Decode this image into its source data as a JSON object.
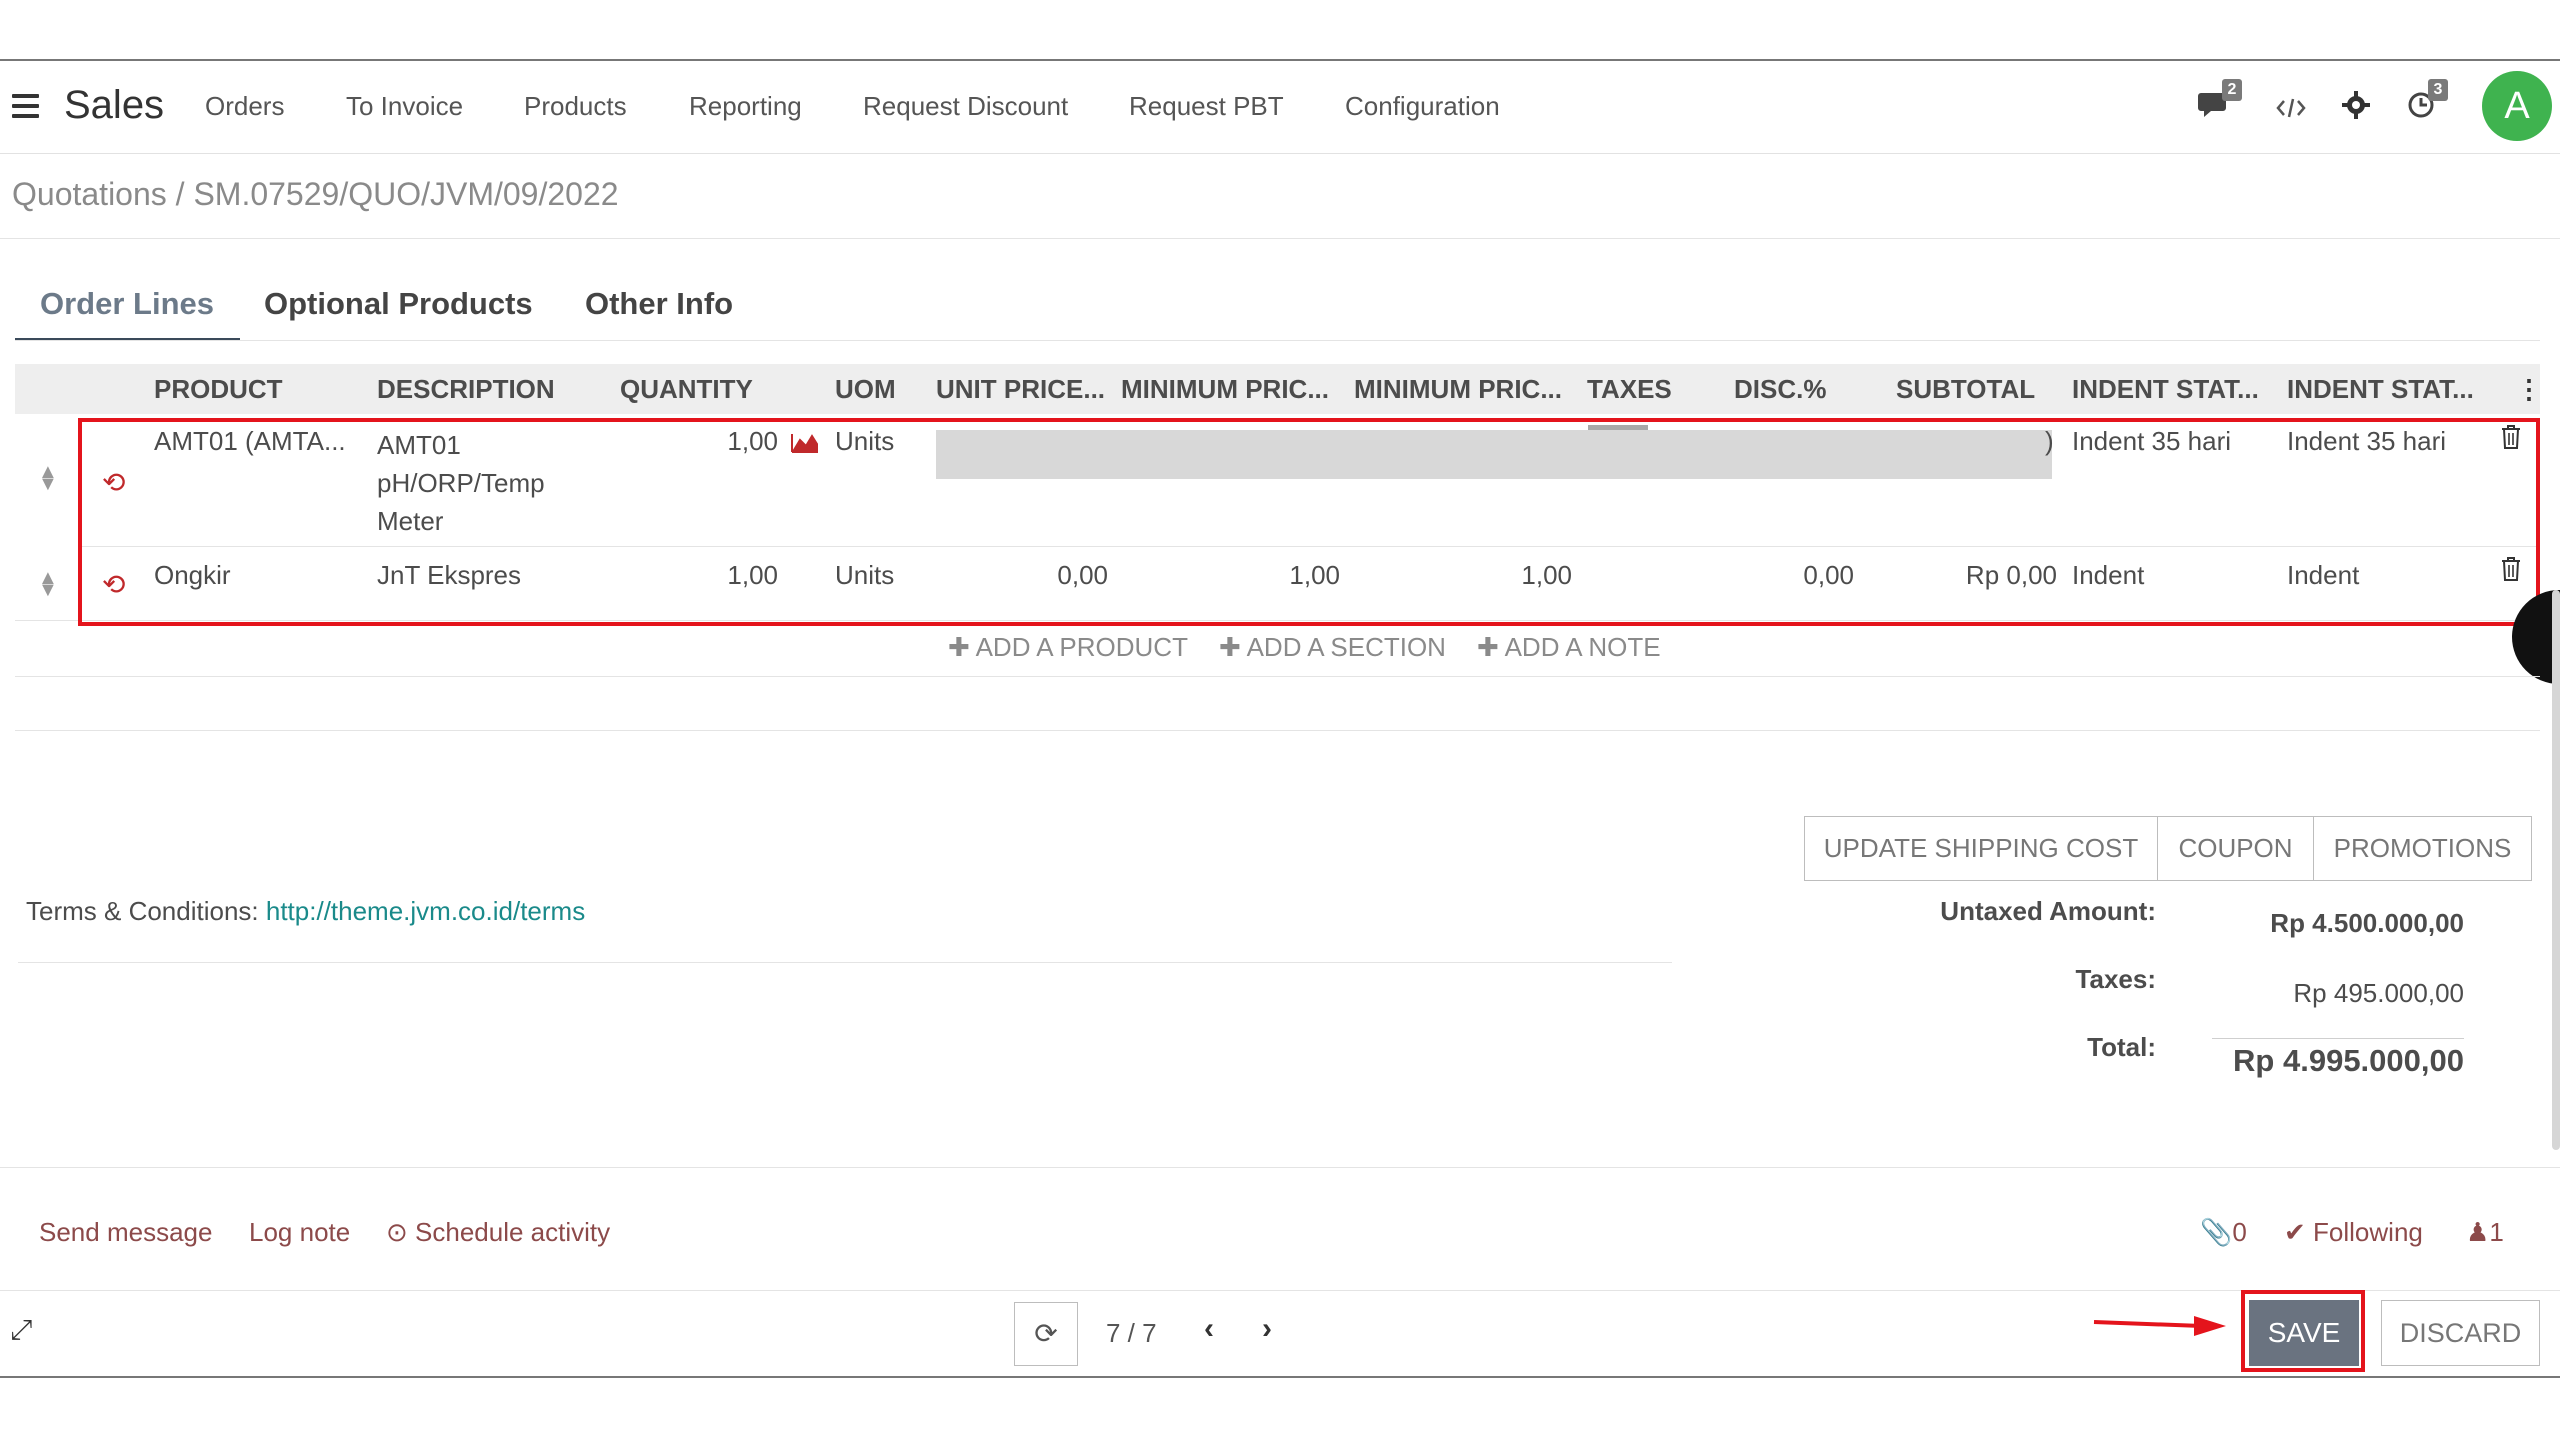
{
  "navbar": {
    "brand": "Sales",
    "menu": [
      "Orders",
      "To Invoice",
      "Products",
      "Reporting",
      "Request Discount",
      "Request PBT",
      "Configuration"
    ],
    "messages_badge": "2",
    "activities_badge": "3",
    "avatar_letter": "A"
  },
  "breadcrumb": {
    "parent": "Quotations",
    "separator": " / ",
    "current": "SM.07529/QUO/JVM/09/2022"
  },
  "tabs": [
    "Order Lines",
    "Optional Products",
    "Other Info"
  ],
  "table": {
    "headers": [
      "PRODUCT",
      "DESCRIPTION",
      "QUANTITY",
      "UOM",
      "UNIT PRICE...",
      "MINIMUM PRIC...",
      "MINIMUM PRIC...",
      "TAXES",
      "DISC.%",
      "SUBTOTAL",
      "INDENT STAT...",
      "INDENT STAT..."
    ],
    "rows": [
      {
        "product": "AMT01 (AMTA...",
        "description_lines": [
          "AMT01",
          "pH/ORP/Temp",
          "Meter"
        ],
        "quantity": "1,00",
        "uom": "Units",
        "unit_price": "",
        "min_price_1": "",
        "min_price_2": "",
        "taxes": "",
        "disc": "",
        "subtotal": "",
        "fragment": ")",
        "indent_1": "Indent 35 hari",
        "indent_2": "Indent 35 hari"
      },
      {
        "product": "Ongkir",
        "description_lines": [
          "JnT Ekspres"
        ],
        "quantity": "1,00",
        "uom": "Units",
        "unit_price": "0,00",
        "min_price_1": "1,00",
        "min_price_2": "1,00",
        "taxes": "",
        "disc": "0,00",
        "subtotal": "Rp 0,00",
        "indent_1": "Indent",
        "indent_2": "Indent"
      }
    ],
    "add_product": "ADD A PRODUCT",
    "add_section": "ADD A SECTION",
    "add_note": "ADD A NOTE"
  },
  "actions": {
    "update_shipping": "UPDATE SHIPPING COST",
    "coupon": "COUPON",
    "promotions": "PROMOTIONS"
  },
  "terms": {
    "label": "Terms & Conditions: ",
    "link": "http://theme.jvm.co.id/terms"
  },
  "totals": {
    "untaxed_label": "Untaxed Amount:",
    "untaxed_value": "Rp 4.500.000,00",
    "taxes_label": "Taxes:",
    "taxes_value": "Rp 495.000,00",
    "total_label": "Total:",
    "total_value": "Rp 4.995.000,00"
  },
  "chatter": {
    "send_message": "Send message",
    "log_note": "Log note",
    "schedule_activity": "Schedule activity",
    "attachments": "0",
    "following": "Following",
    "followers": "1"
  },
  "footer": {
    "pager": "7 / 7",
    "save": "SAVE",
    "discard": "DISCARD"
  },
  "colors": {
    "highlight_red": "#e4141c",
    "avatar_green": "#3fb34f",
    "link_teal": "#1a8a8a",
    "chatter_brown": "#8c4a4a"
  }
}
